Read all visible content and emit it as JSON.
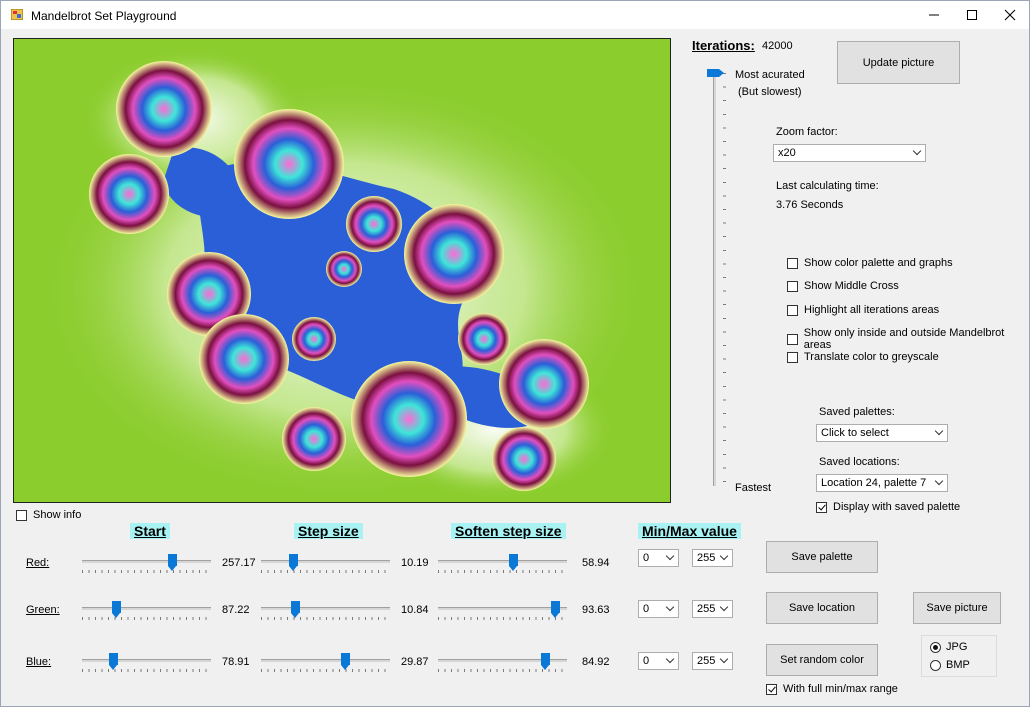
{
  "window": {
    "title": "Mandelbrot Set Playground"
  },
  "info": {
    "show_info_label": "Show info",
    "show_info_checked": false
  },
  "iterations": {
    "label": "Iterations:",
    "value": "42000",
    "most_label": "Most acurated",
    "most_sub": "(But slowest)",
    "fastest_label": "Fastest",
    "level": 1.0
  },
  "buttons": {
    "update": "Update picture",
    "save_palette": "Save  palette",
    "save_location": "Save location",
    "save_picture": "Save picture",
    "random_color": "Set random color"
  },
  "zoom": {
    "label": "Zoom factor:",
    "value": "x20"
  },
  "calc": {
    "label": "Last calculating time:",
    "value": "3.76 Seconds"
  },
  "options": [
    {
      "label": "Show color palette and graphs",
      "checked": false
    },
    {
      "label": "Show Middle Cross",
      "checked": false
    },
    {
      "label": "Highlight all iterations areas",
      "checked": false
    },
    {
      "label": "Show only inside and outside Mandelbrot areas",
      "checked": false
    },
    {
      "label": "Translate color to greyscale",
      "checked": false
    }
  ],
  "saved": {
    "palettes_label": "Saved palettes:",
    "palettes_value": "Click to select",
    "locations_label": "Saved locations:",
    "locations_value": "Location 24, palette 7",
    "display_saved_label": "Display with saved palette",
    "display_saved_checked": true
  },
  "headers": {
    "start": "Start",
    "step": "Step size",
    "soften": "Soften step size",
    "minmax": "Min/Max value"
  },
  "rows": [
    {
      "label": "Red:",
      "start": "257.17",
      "step": "10.19",
      "soften": "58.94",
      "min": "0",
      "max": "255",
      "start_pos": 0.7,
      "step_pos": 0.25,
      "soften_pos": 0.58
    },
    {
      "label": "Green:",
      "start": "87.22",
      "step": "10.84",
      "soften": "93.63",
      "min": "0",
      "max": "255",
      "start_pos": 0.26,
      "step_pos": 0.26,
      "soften_pos": 0.91
    },
    {
      "label": "Blue:",
      "start": "78.91",
      "step": "29.87",
      "soften": "84.92",
      "min": "0",
      "max": "255",
      "start_pos": 0.24,
      "step_pos": 0.65,
      "soften_pos": 0.83
    }
  ],
  "format": {
    "jpg": "JPG",
    "bmp": "BMP",
    "selected": "JPG"
  },
  "full_range": {
    "label": "With full min/max range",
    "checked": true
  },
  "colors": {
    "background": "#8ccd2e",
    "fractal_blue": "#2a5fd8",
    "fractal_magenta": "#e24fbf",
    "fractal_cyan": "#41e0d6",
    "slider_thumb": "#0a78d7",
    "header_highlight": "#a8f2f4"
  }
}
